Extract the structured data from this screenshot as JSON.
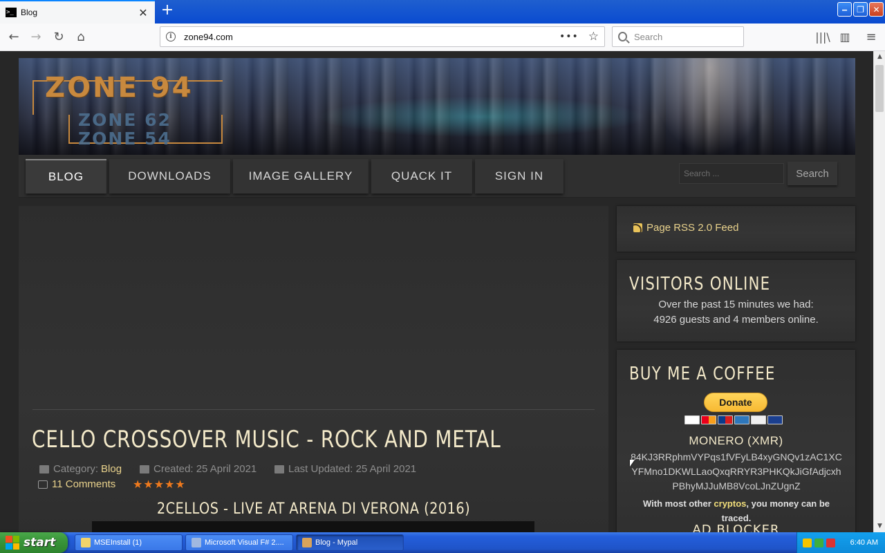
{
  "browser": {
    "tab_title": "Blog",
    "favicon_text": ">_",
    "url": "zone94.com",
    "search_placeholder": "Search"
  },
  "banner": {
    "logo_main": "ZONE 94",
    "logo_sub1": "ZONE 62",
    "logo_sub2": "ZONE 54"
  },
  "menu": {
    "items": [
      {
        "label": "BLOG"
      },
      {
        "label": "DOWNLOADS"
      },
      {
        "label": "IMAGE GALLERY"
      },
      {
        "label": "QUACK IT"
      },
      {
        "label": "SIGN IN"
      }
    ],
    "search_placeholder": "Search ...",
    "search_button": "Search"
  },
  "article": {
    "title": "CELLO CROSSOVER MUSIC - ROCK AND METAL",
    "category_label": "Category:",
    "category_value": "Blog",
    "created": "Created: 25 April 2021",
    "updated": "Last Updated: 25 April 2021",
    "comments": "11 Comments",
    "rating_stars": 5,
    "video_title": "2CELLOS - LIVE AT ARENA DI VERONA (2016)"
  },
  "sidebar": {
    "rss_label": "Page RSS 2.0 Feed",
    "visitors_heading": "VISITORS ONLINE",
    "visitors_line1": "Over the past 15 minutes we had:",
    "visitors_line2": "4926 guests and 4 members online.",
    "coffee_heading": "BUY ME A COFFEE",
    "donate_label": "Donate",
    "monero_title": "MONERO (XMR)",
    "monero_address": "84KJ3RRphmVYPqs1fVFyLB4xyGNQv1zAC1XCYFMno1DKWLLaoQxqRRYR3PHKQkJiGfAdjcxhPBhyMJJuMB8VcoLJnZUgnZ",
    "crypto_note_prefix": "With most other ",
    "crypto_note_link": "cryptos",
    "crypto_note_suffix": ", you money can be traced.",
    "adblock_heading": "AD BLOCKER"
  },
  "taskbar": {
    "start_label": "start",
    "tasks": [
      {
        "label": "MSEInstall (1)"
      },
      {
        "label": "Microsoft Visual F# 2...."
      },
      {
        "label": "Blog - Mypal"
      }
    ],
    "clock": "6:40 AM"
  },
  "colors": {
    "accent_gold": "#e9d28c",
    "heading_cream": "#f3e9c9",
    "star_orange": "#f07a1d",
    "xp_blue": "#245edb",
    "xp_green": "#3a963a"
  }
}
